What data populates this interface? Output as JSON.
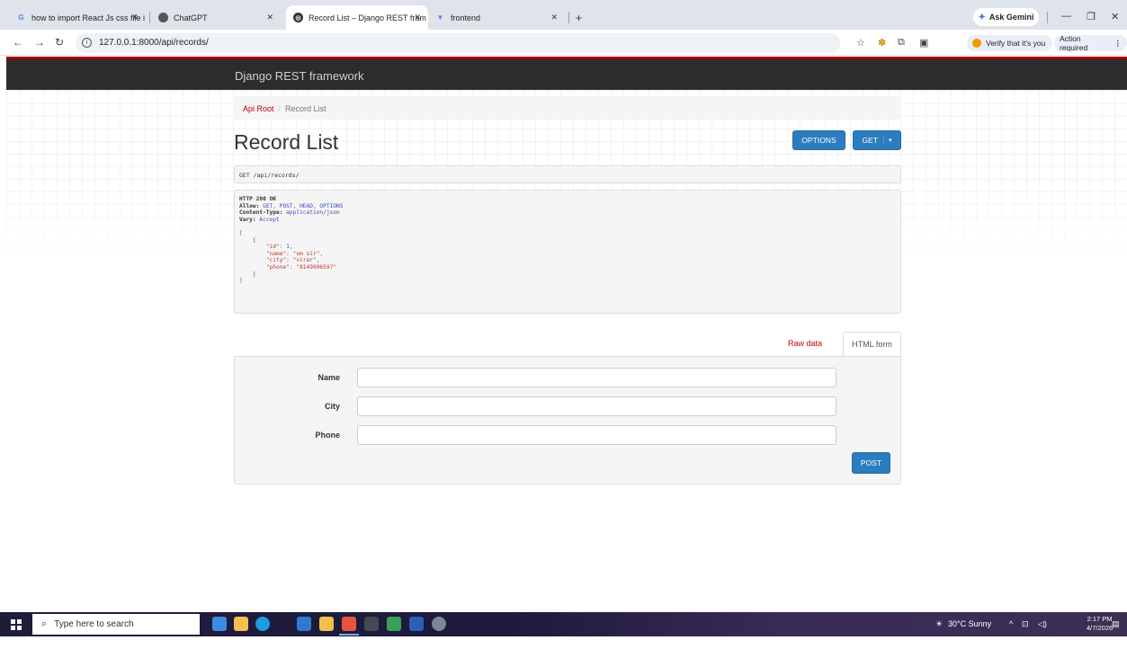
{
  "browser": {
    "tabs": [
      {
        "title": "how to import React Js css file i",
        "favicon": "google-icon",
        "active": false
      },
      {
        "title": "ChatGPT",
        "favicon": "chatgpt-icon",
        "active": false
      },
      {
        "title": "Record List – Django REST fram",
        "favicon": "globe-icon",
        "active": true
      },
      {
        "title": "frontend",
        "favicon": "vite-icon",
        "active": false
      }
    ],
    "gemini_label": "Ask Gemini",
    "url": "127.0.0.1:8000/api/records/",
    "verify_label": "Verify that it's you",
    "action_label": "Action required"
  },
  "page": {
    "brand": "Django REST framework",
    "breadcrumb": {
      "root": "Api Root",
      "current": "Record List"
    },
    "title": "Record List",
    "options_label": "OPTIONS",
    "get_label": "GET",
    "request_line": "GET /api/records/",
    "response": {
      "status": "HTTP 200 OK",
      "allow_key": "Allow:",
      "allow_value": "GET, POST, HEAD, OPTIONS",
      "content_type_key": "Content-Type:",
      "content_type_value": "application/json",
      "vary_key": "Vary:",
      "vary_value": "Accept",
      "records": [
        {
          "id": "1",
          "name": "\"om sir\"",
          "city": "\"virar\"",
          "phone": "\"8149996597\""
        }
      ]
    },
    "form_tabs": {
      "raw": "Raw data",
      "html": "HTML form"
    },
    "form": {
      "fields": [
        {
          "label": "Name",
          "value": ""
        },
        {
          "label": "City",
          "value": ""
        },
        {
          "label": "Phone",
          "value": ""
        }
      ],
      "submit_label": "POST"
    }
  },
  "taskbar": {
    "search_placeholder": "Type here to search",
    "weather": "30°C  Sunny",
    "time": "2:17 PM",
    "date": "4/7/2026"
  }
}
